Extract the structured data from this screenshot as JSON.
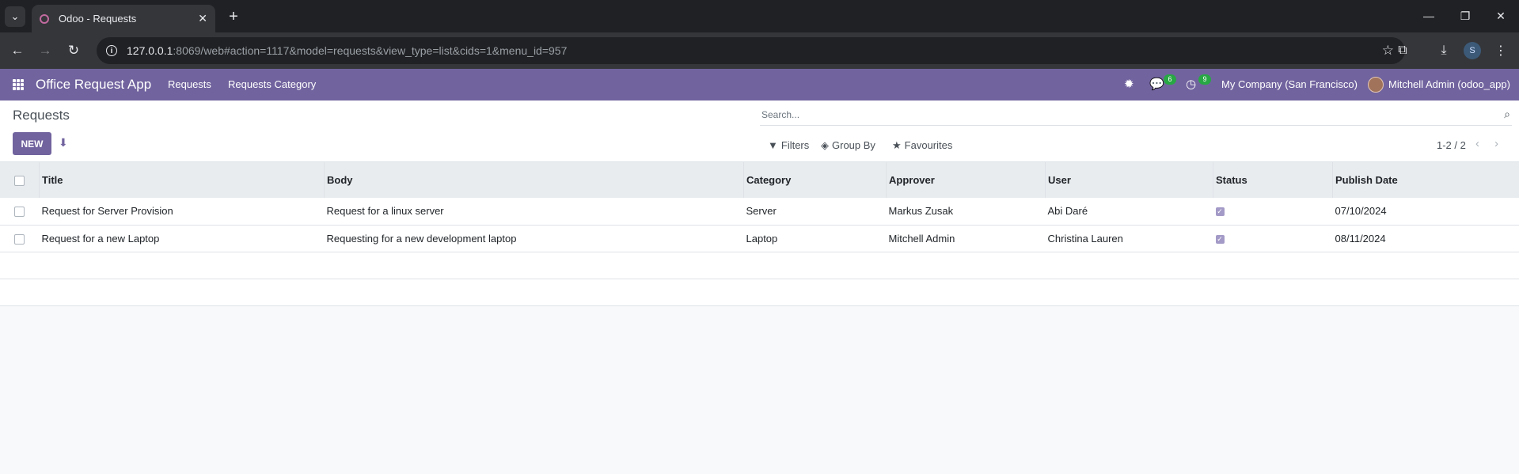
{
  "browser": {
    "tab_title": "Odoo - Requests",
    "url_host": "127.0.0.1",
    "url_rest": ":8069/web#action=1117&model=requests&view_type=list&cids=1&menu_id=957",
    "profile_initial": "S"
  },
  "navbar": {
    "app_name": "Office Request App",
    "menu": [
      "Requests",
      "Requests Category"
    ],
    "messages_count": "6",
    "activities_count": "9",
    "company": "My Company (San Francisco)",
    "user": "Mitchell Admin (odoo_app)"
  },
  "control_panel": {
    "breadcrumb": "Requests",
    "new_label": "NEW",
    "search_placeholder": "Search...",
    "filters_label": "Filters",
    "group_by_label": "Group By",
    "favourites_label": "Favourites",
    "pager": "1-2 / 2"
  },
  "list": {
    "columns": [
      "Title",
      "Body",
      "Category",
      "Approver",
      "User",
      "Status",
      "Publish Date"
    ],
    "rows": [
      [
        "Request for Server Provision",
        "Request for a linux server",
        "Server",
        "Markus Zusak",
        "Abi Daré",
        "checked",
        "07/10/2024"
      ],
      [
        "Request for a new Laptop",
        "Requesting for a new development laptop",
        "Laptop",
        "Mitchell Admin",
        "Christina Lauren",
        "checked",
        "08/11/2024"
      ]
    ]
  },
  "colors": {
    "brand": "#71639e",
    "badge": "#28a745"
  }
}
